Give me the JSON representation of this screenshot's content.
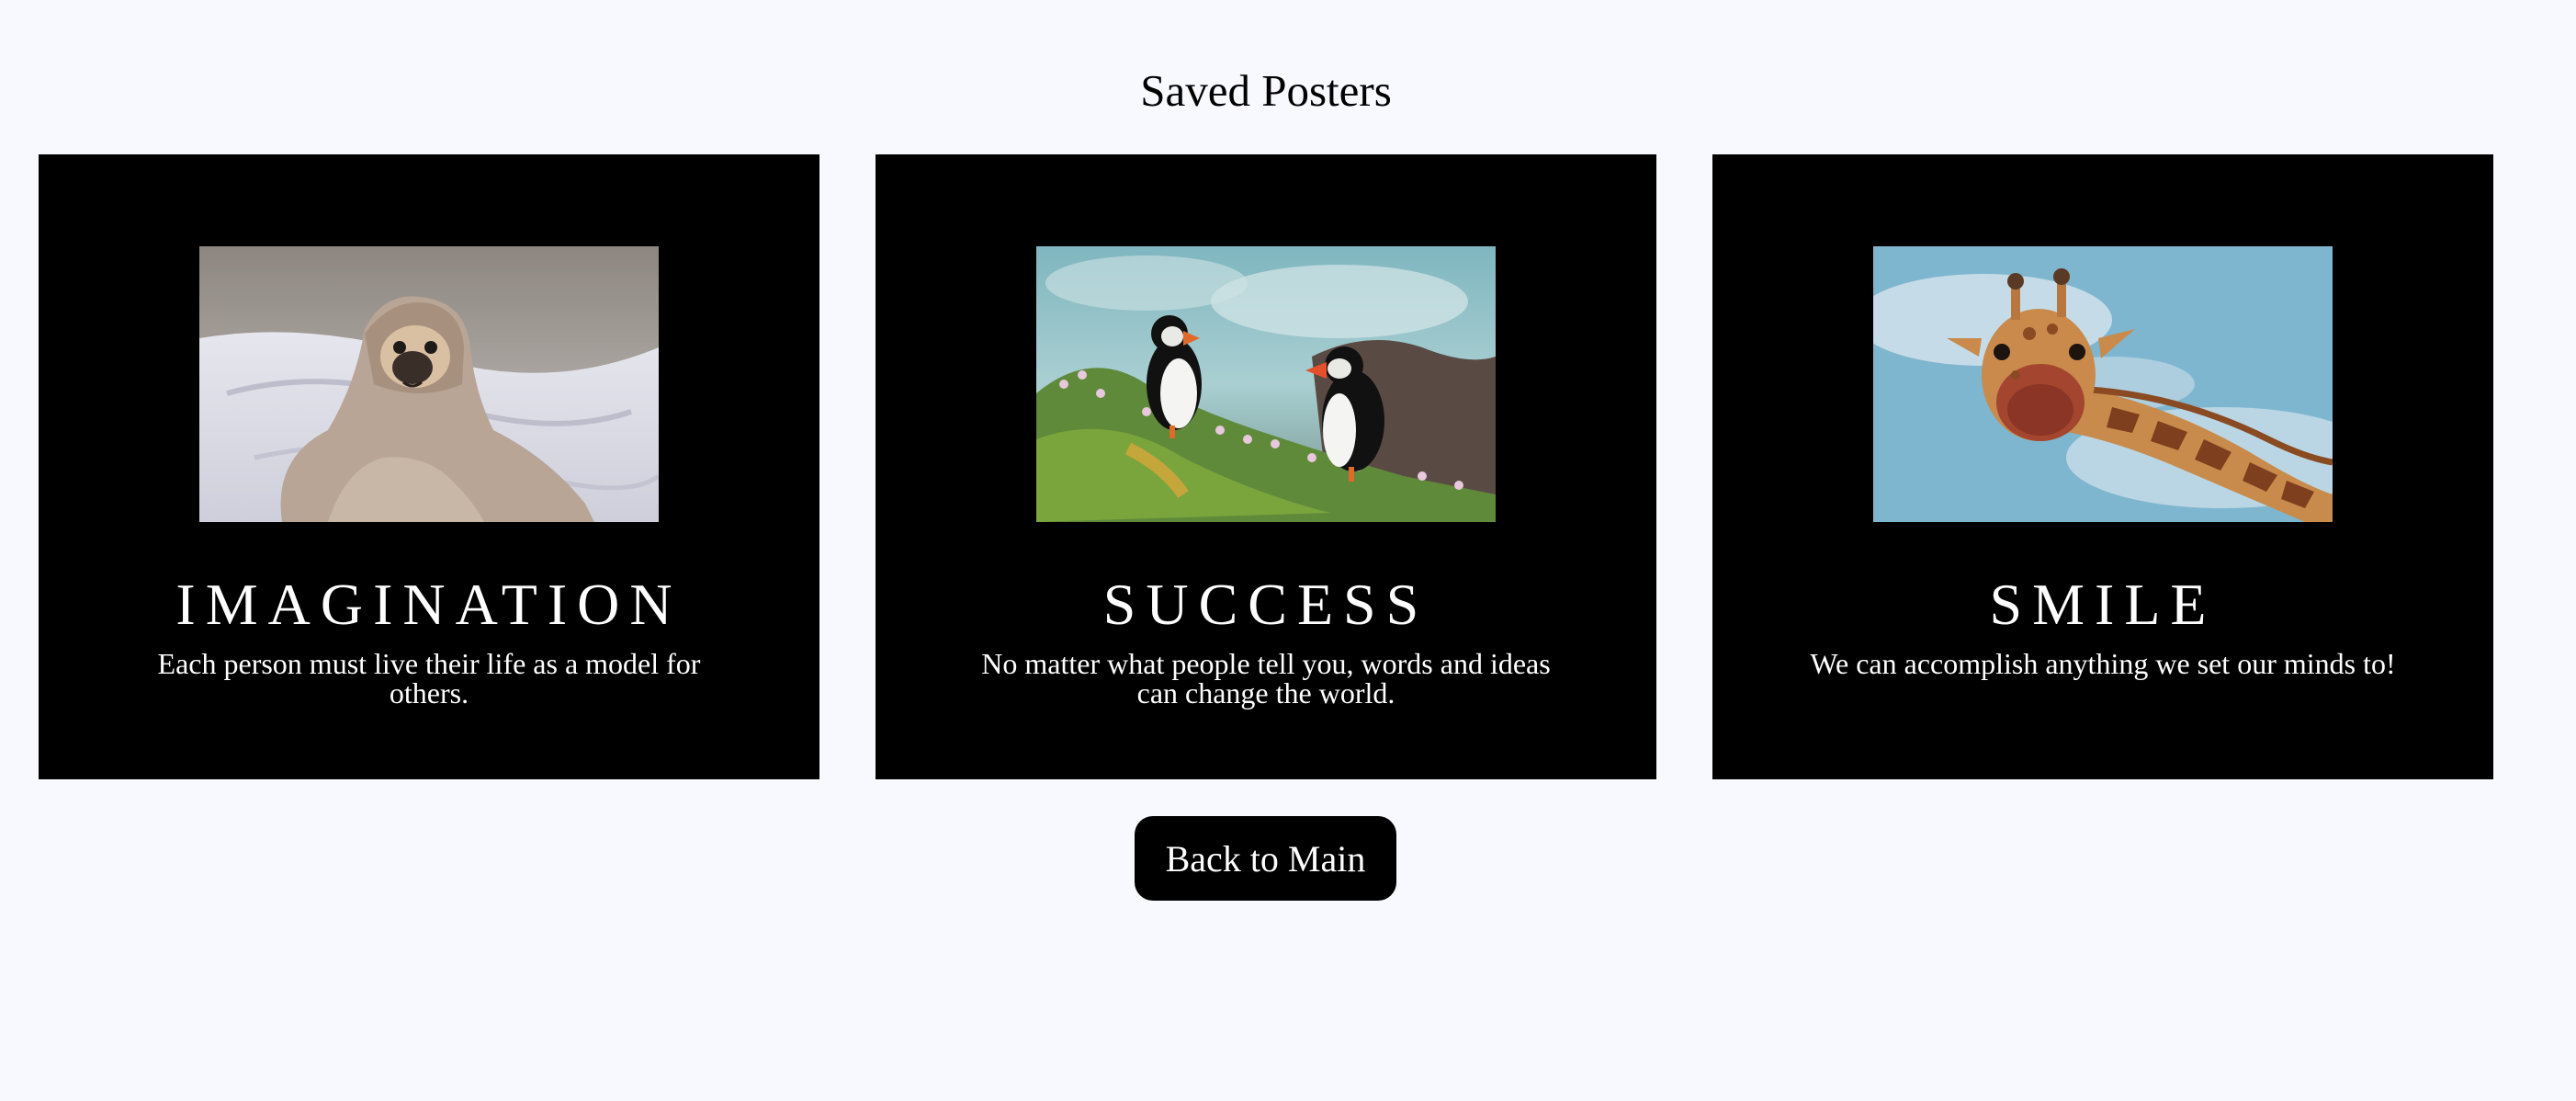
{
  "page": {
    "title": "Saved Posters",
    "background_color": "#f8f8ff"
  },
  "posters": [
    {
      "title": "IMAGINATION",
      "quote": "Each person must live their life as a model for others.",
      "image": "pug-in-blanket-photo"
    },
    {
      "title": "SUCCESS",
      "quote": "No matter what people tell you, words and ideas can change the world.",
      "image": "puffins-photo"
    },
    {
      "title": "SMILE",
      "quote": "We can accomplish anything we set our minds to!",
      "image": "giraffe-photo"
    }
  ],
  "actions": {
    "back_label": "Back to Main"
  },
  "colors": {
    "poster_background": "#000000",
    "poster_text": "#ffffff",
    "button_background": "#000000",
    "button_text": "#ffffff"
  }
}
